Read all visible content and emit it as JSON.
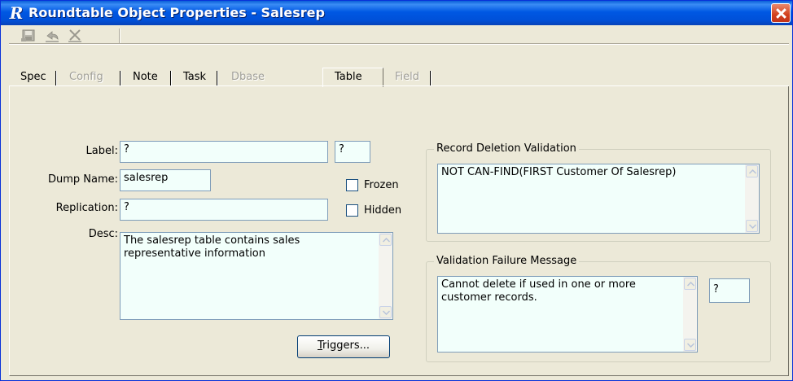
{
  "window": {
    "title": "Roundtable Object Properties - Salesrep",
    "app_icon_letter": "R"
  },
  "toolbar": {
    "buttons": [
      {
        "name": "save-icon",
        "enabled": false
      },
      {
        "name": "undo-icon",
        "enabled": false
      },
      {
        "name": "delete-icon",
        "enabled": false
      }
    ]
  },
  "tabs": [
    {
      "label": "Spec",
      "enabled": true,
      "active": false
    },
    {
      "label": "Config",
      "enabled": false,
      "active": false
    },
    {
      "label": "Note",
      "enabled": true,
      "active": false
    },
    {
      "label": "Task",
      "enabled": true,
      "active": false
    },
    {
      "label": "Dbase",
      "enabled": false,
      "active": false
    },
    {
      "label": "Table",
      "enabled": true,
      "active": true
    },
    {
      "label": "Field",
      "enabled": false,
      "active": false
    }
  ],
  "form": {
    "label_label": "Label:",
    "label_value": "?",
    "label_extra_value": "?",
    "dump_name_label": "Dump Name:",
    "dump_name_value": "salesrep",
    "replication_label": "Replication:",
    "replication_value": "?",
    "desc_label": "Desc:",
    "desc_value": "The salesrep table contains sales representative information",
    "frozen_label": "Frozen",
    "frozen_checked": false,
    "hidden_label": "Hidden",
    "hidden_checked": false,
    "triggers_button_label": "riggers...",
    "triggers_button_mnemonic": "T"
  },
  "record_deletion": {
    "title": "Record Deletion Validation",
    "value": "NOT CAN-FIND(FIRST Customer Of Salesrep)"
  },
  "validation_failure": {
    "title": "Validation Failure Message",
    "value": "Cannot delete if used in one or more customer records.",
    "extra_value": "?"
  }
}
